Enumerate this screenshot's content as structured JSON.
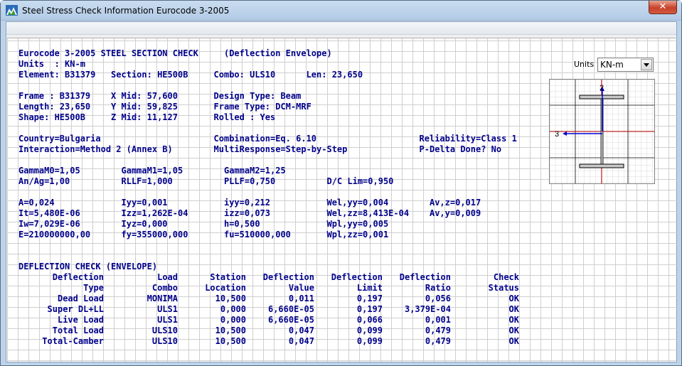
{
  "window": {
    "title": "Steel Stress Check Information  Eurocode 3-2005",
    "close_label": "✕"
  },
  "units_control": {
    "label": "Units",
    "selected": "KN-m"
  },
  "report": {
    "header": {
      "line1": "Eurocode 3-2005 STEEL SECTION CHECK     (Deflection Envelope)",
      "line2": "Units  : KN-m",
      "line3": "Element: B31379   Section: HE500B     Combo: ULS10      Len: 23,650"
    },
    "frame": {
      "line1": "Frame : B31379    X Mid: 57,600       Design Type: Beam",
      "line2": "Length: 23,650    Y Mid: 59,825       Frame Type: DCM-MRF",
      "line3": "Shape: HE500B     Z Mid: 11,127       Rolled : Yes"
    },
    "country": {
      "line1": "Country=Bulgaria                      Combination=Eq. 6.10                    Reliability=Class 1",
      "line2": "Interaction=Method 2 (Annex B)        MultiResponse=Step-by-Step              P-Delta Done? No"
    },
    "factors": {
      "line1": "GammaM0=1,05        GammaM1=1,05        GammaM2=1,25",
      "line2": "An/Ag=1,00          RLLF=1,000          PLLF=0,750          D/C Lim=0,950"
    },
    "properties": {
      "line1": "A=0,024             Iyy=0,001           iyy=0,212           Wel,yy=0,004        Av,z=0,017",
      "line2": "It=5,480E-06        Izz=1,262E-04       izz=0,073           Wel,zz=8,413E-04    Av,y=0,009",
      "line3": "Iw=7,029E-06        Iyz=0,000           h=0,500             Wpl,yy=0,005",
      "line4": "E=210000000,00      fy=355000,000       fu=510000,000       Wpl,zz=0,001"
    },
    "deflection": {
      "title": "DEFLECTION CHECK (ENVELOPE)",
      "headers_top": [
        "Deflection",
        "Load",
        "Station",
        "Deflection",
        "Deflection",
        "Deflection",
        "Check"
      ],
      "headers_bottom": [
        "Type",
        "Combo",
        "Location",
        "Value",
        "Limit",
        "Ratio",
        "Status"
      ],
      "rows": [
        [
          "Dead Load",
          "MONIMA",
          "10,500",
          "0,011",
          "0,197",
          "0,056",
          "OK"
        ],
        [
          "Super DL+LL",
          "ULS1",
          "0,000",
          "6,660E-05",
          "0,197",
          "3,379E-04",
          "OK"
        ],
        [
          "Live Load",
          "ULS1",
          "0,000",
          "6,660E-05",
          "0,066",
          "0,001",
          "OK"
        ],
        [
          "Total Load",
          "ULS10",
          "10,500",
          "0,047",
          "0,099",
          "0,479",
          "OK"
        ],
        [
          "Total-Camber",
          "ULS10",
          "10,500",
          "0,047",
          "0,099",
          "0,479",
          "OK"
        ]
      ]
    }
  },
  "section_view": {
    "axis_2": "2",
    "axis_3": "3"
  },
  "colors": {
    "text": "#00008b",
    "axis": "#0000cd",
    "grid": "#cfcfcf"
  }
}
